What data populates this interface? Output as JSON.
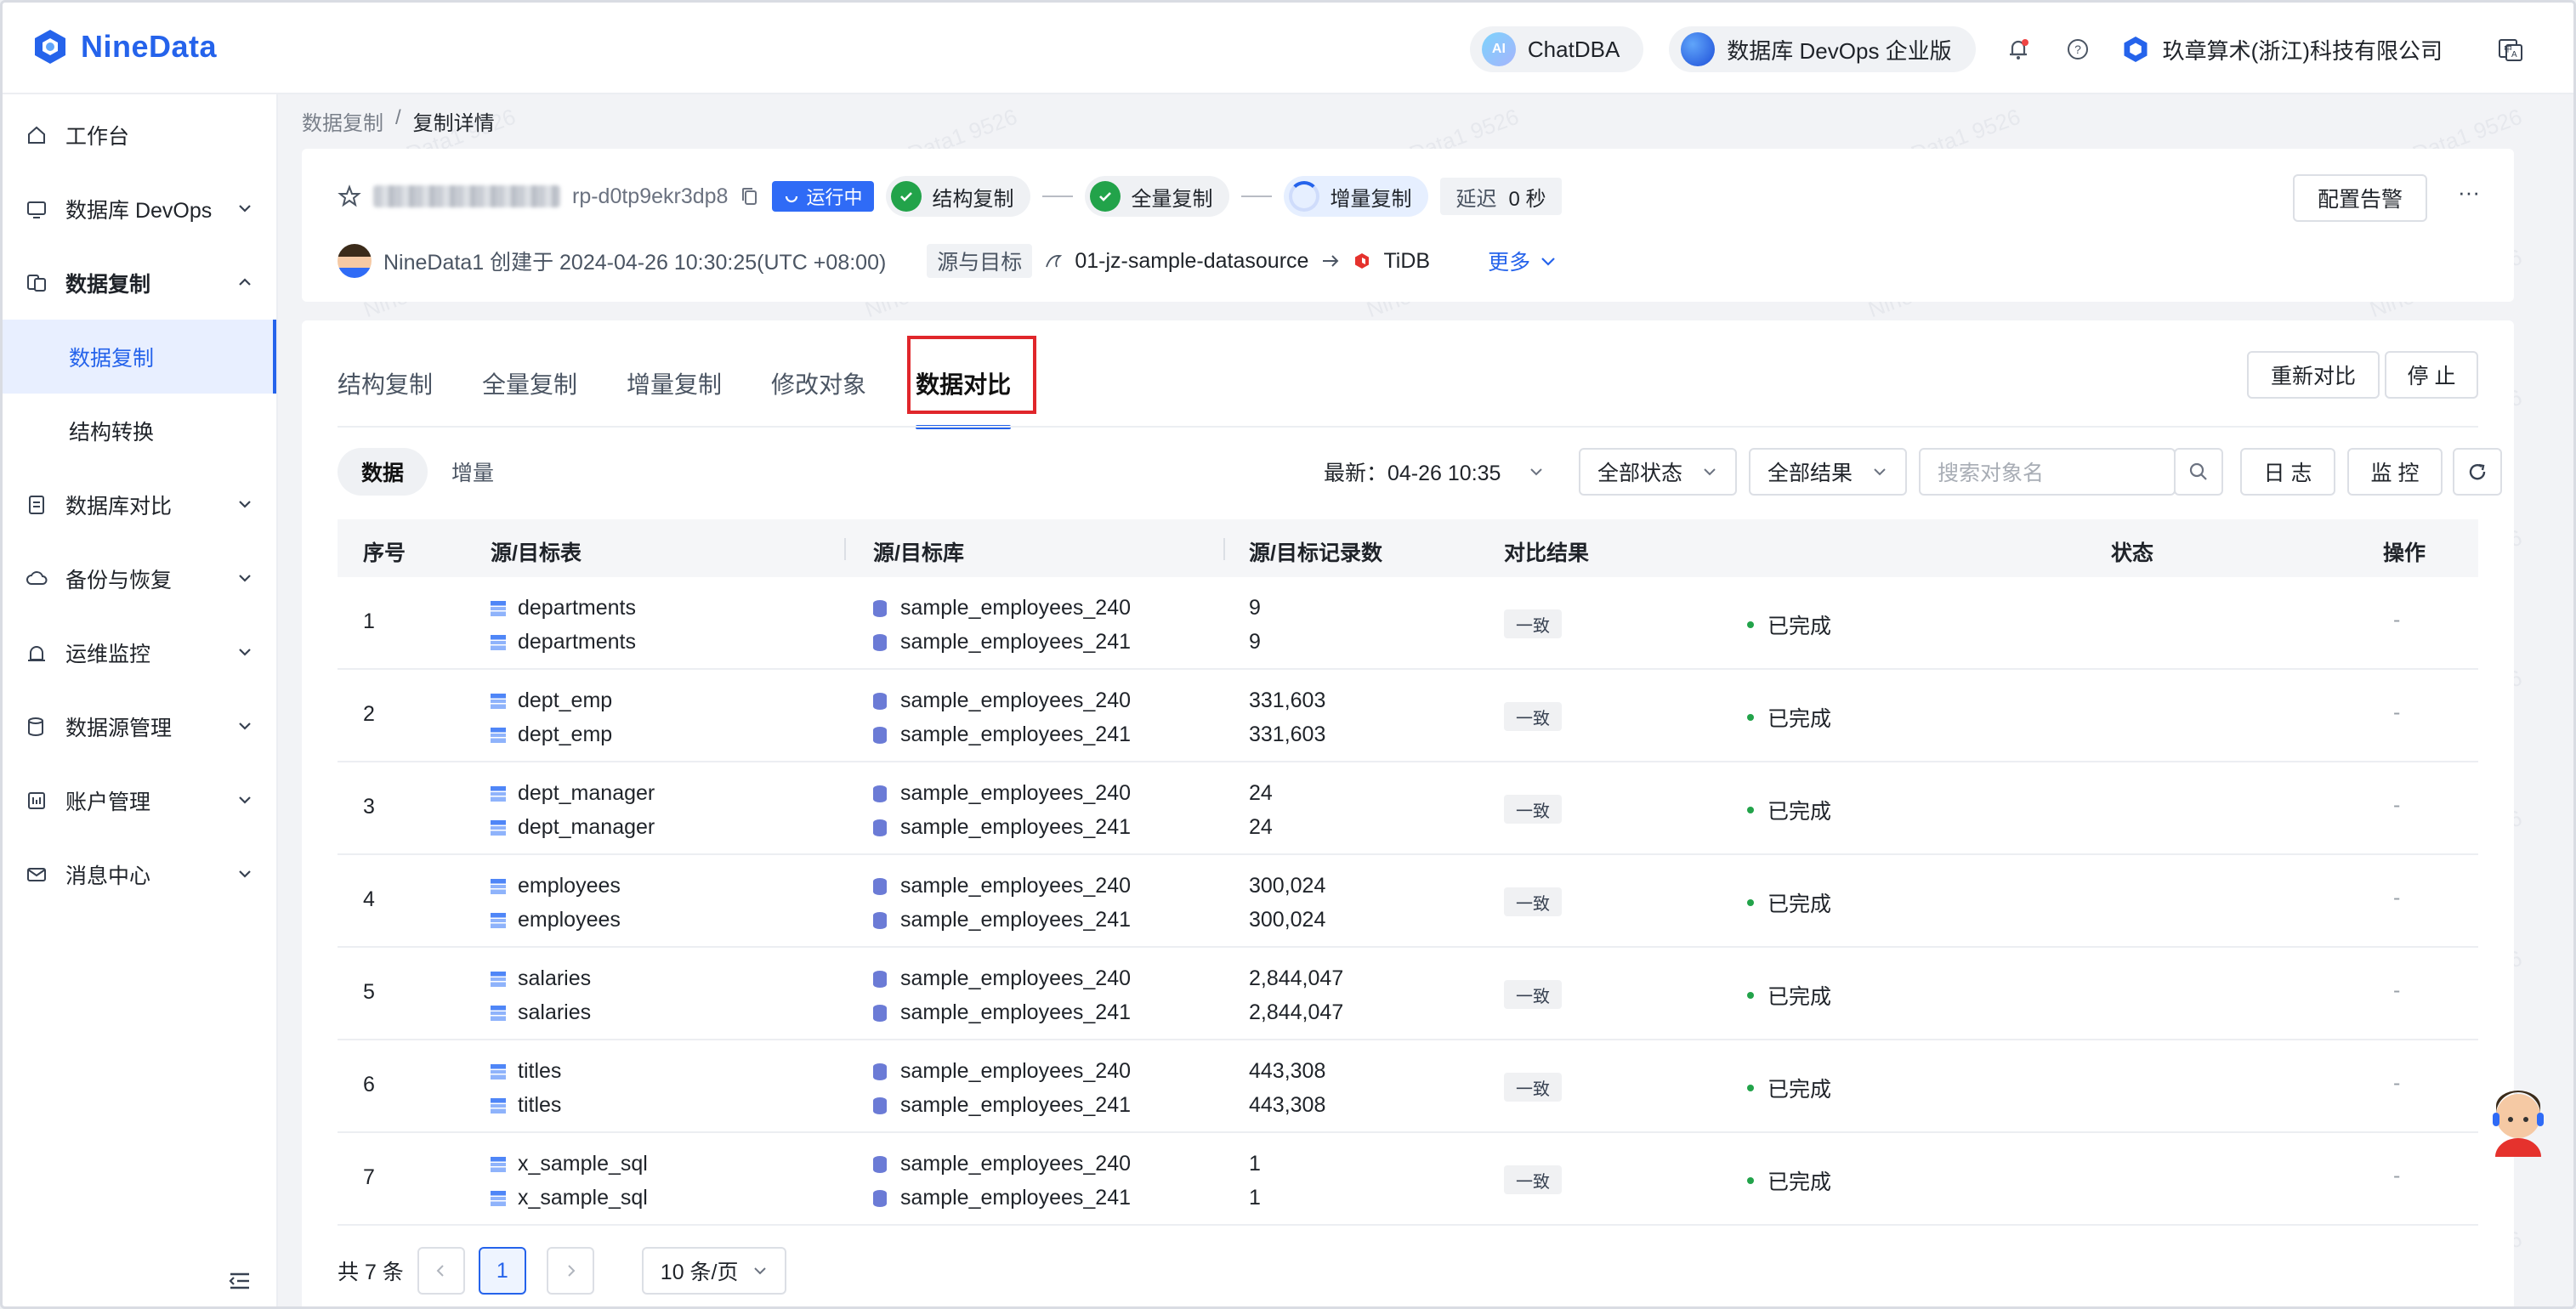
{
  "app": {
    "name": "NineData"
  },
  "header": {
    "chatdba_label": "ChatDBA",
    "ai_badge": "AI",
    "edition_label": "数据库 DevOps 企业版",
    "company": "玖章算术(浙江)科技有限公司"
  },
  "sidebar": {
    "items": [
      {
        "label": "工作台"
      },
      {
        "label": "数据库 DevOps"
      },
      {
        "label": "数据复制"
      },
      {
        "label": "数据库对比"
      },
      {
        "label": "备份与恢复"
      },
      {
        "label": "运维监控"
      },
      {
        "label": "数据源管理"
      },
      {
        "label": "账户管理"
      },
      {
        "label": "消息中心"
      }
    ],
    "sub_items": [
      {
        "label": "数据复制"
      },
      {
        "label": "结构转换"
      }
    ]
  },
  "breadcrumb": {
    "parent": "数据复制",
    "sep": "/",
    "current": "复制详情"
  },
  "task": {
    "id": "rp-d0tp9ekr3dp8",
    "status": "运行中",
    "steps": [
      "结构复制",
      "全量复制",
      "增量复制"
    ],
    "delay_label": "延迟",
    "delay_value": "0 秒",
    "creator_line": "NineData1 创建于 2024-04-26 10:30:25(UTC +08:00)",
    "src_target_label": "源与目标",
    "source": "01-jz-sample-datasource",
    "target": "TiDB",
    "more": "更多",
    "alarm_btn": "配置告警",
    "ellipsis": "···"
  },
  "tabs": [
    "结构复制",
    "全量复制",
    "增量复制",
    "修改对象",
    "数据对比"
  ],
  "actions": {
    "recompare": "重新对比",
    "stop": "停 止"
  },
  "subtabs": [
    "数据",
    "增量"
  ],
  "filters": {
    "latest": "最新：04-26 10:35",
    "status": "全部状态",
    "result": "全部结果",
    "search_placeholder": "搜索对象名",
    "log": "日 志",
    "monitor": "监 控"
  },
  "table": {
    "headers": [
      "序号",
      "源/目标表",
      "源/目标库",
      "源/目标记录数",
      "对比结果",
      "状态",
      "操作"
    ],
    "rows": [
      {
        "no": "1",
        "src_table": "departments",
        "dst_table": "departments",
        "src_db": "sample_employees_240",
        "dst_db": "sample_employees_241",
        "src_count": "9",
        "dst_count": "9",
        "result": "一致",
        "status": "已完成",
        "op": "-"
      },
      {
        "no": "2",
        "src_table": "dept_emp",
        "dst_table": "dept_emp",
        "src_db": "sample_employees_240",
        "dst_db": "sample_employees_241",
        "src_count": "331,603",
        "dst_count": "331,603",
        "result": "一致",
        "status": "已完成",
        "op": "-"
      },
      {
        "no": "3",
        "src_table": "dept_manager",
        "dst_table": "dept_manager",
        "src_db": "sample_employees_240",
        "dst_db": "sample_employees_241",
        "src_count": "24",
        "dst_count": "24",
        "result": "一致",
        "status": "已完成",
        "op": "-"
      },
      {
        "no": "4",
        "src_table": "employees",
        "dst_table": "employees",
        "src_db": "sample_employees_240",
        "dst_db": "sample_employees_241",
        "src_count": "300,024",
        "dst_count": "300,024",
        "result": "一致",
        "status": "已完成",
        "op": "-"
      },
      {
        "no": "5",
        "src_table": "salaries",
        "dst_table": "salaries",
        "src_db": "sample_employees_240",
        "dst_db": "sample_employees_241",
        "src_count": "2,844,047",
        "dst_count": "2,844,047",
        "result": "一致",
        "status": "已完成",
        "op": "-"
      },
      {
        "no": "6",
        "src_table": "titles",
        "dst_table": "titles",
        "src_db": "sample_employees_240",
        "dst_db": "sample_employees_241",
        "src_count": "443,308",
        "dst_count": "443,308",
        "result": "一致",
        "status": "已完成",
        "op": "-"
      },
      {
        "no": "7",
        "src_table": "x_sample_sql",
        "dst_table": "x_sample_sql",
        "src_db": "sample_employees_240",
        "dst_db": "sample_employees_241",
        "src_count": "1",
        "dst_count": "1",
        "result": "一致",
        "status": "已完成",
        "op": "-"
      }
    ]
  },
  "pagination": {
    "total": "共 7 条",
    "page": "1",
    "page_size": "10 条/页"
  },
  "watermark": "NineData1 9526",
  "colors": {
    "accent": "#2563eb",
    "success": "#22a34a",
    "highlight": "#e0262b"
  }
}
